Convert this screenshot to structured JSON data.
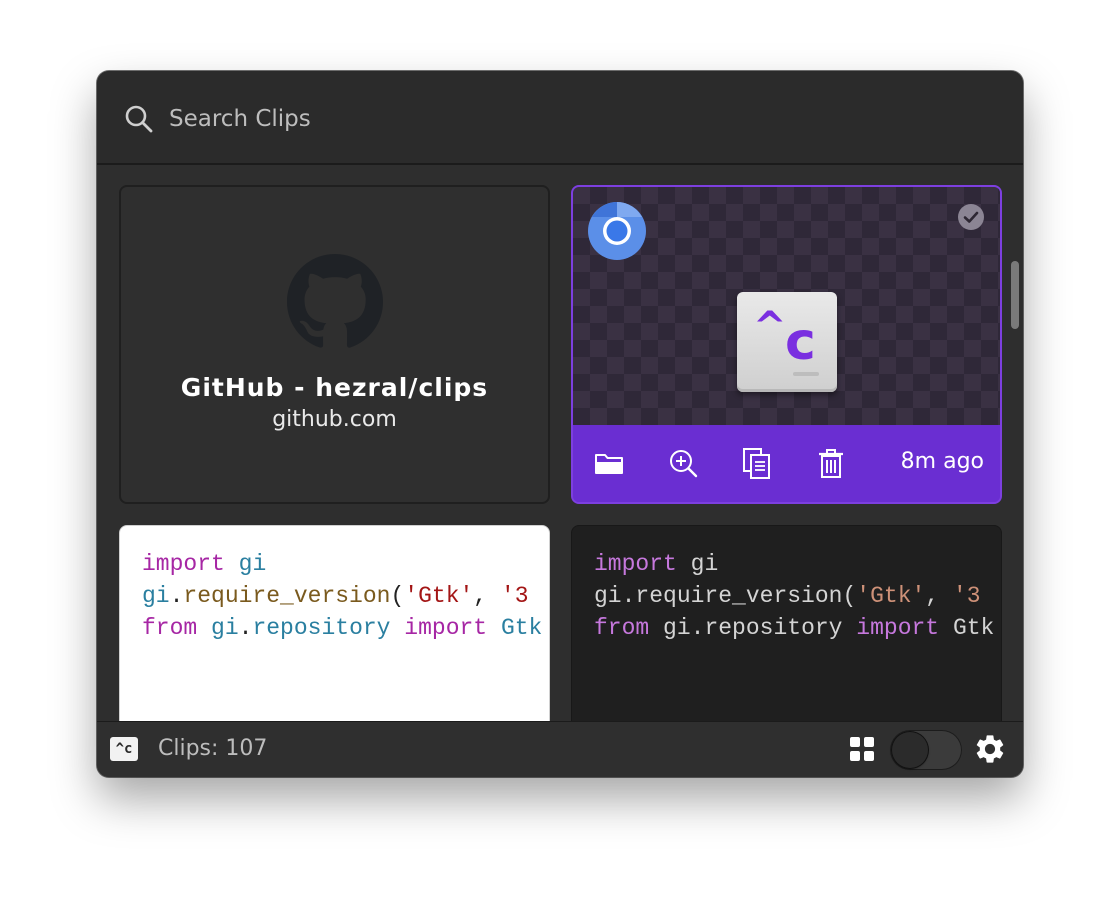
{
  "search": {
    "placeholder": "Search Clips"
  },
  "clips": {
    "link_card": {
      "title": "GitHub - hezral/clips",
      "domain": "github.com",
      "icon": "github-icon"
    },
    "image_card": {
      "source_icon": "chromium-icon",
      "image_icon": "clips-app-icon",
      "image_caret": "^",
      "image_letter": "c",
      "selected": true,
      "timestamp": "8m ago",
      "actions": [
        "folder-icon",
        "zoom-in-icon",
        "copy-icon",
        "trash-icon"
      ],
      "accent_color": "#6a2ed2"
    },
    "code_light": {
      "line1": {
        "kw": "import",
        "id": "gi"
      },
      "line2": {
        "id": "gi",
        "punc1": ".",
        "fn": "require_version",
        "punc2": "(",
        "str1": "'Gtk'",
        "punc3": ", ",
        "str2": "'3"
      },
      "line3": {
        "kw1": "from",
        "id1": "gi",
        "punc": ".",
        "id2": "repository",
        "kw2": "import",
        "id3": "Gtk"
      }
    },
    "code_dark": {
      "line1": {
        "kw": "import",
        "id": "gi"
      },
      "line2": {
        "id": "gi",
        "punc1": ".",
        "fn": "require_version",
        "punc2": "(",
        "str1": "'Gtk'",
        "punc3": ", ",
        "str2": "'3"
      },
      "line3": {
        "kw1": "from",
        "id1": "gi",
        "punc": ".",
        "id2": "repository",
        "kw2": "import",
        "id3": "Gtk"
      }
    }
  },
  "footer": {
    "app_icon_text": "^c",
    "clip_count": "Clips: 107",
    "view_mode_icon": "grid-icon",
    "toggle_on": false,
    "settings_icon": "gear-icon"
  }
}
